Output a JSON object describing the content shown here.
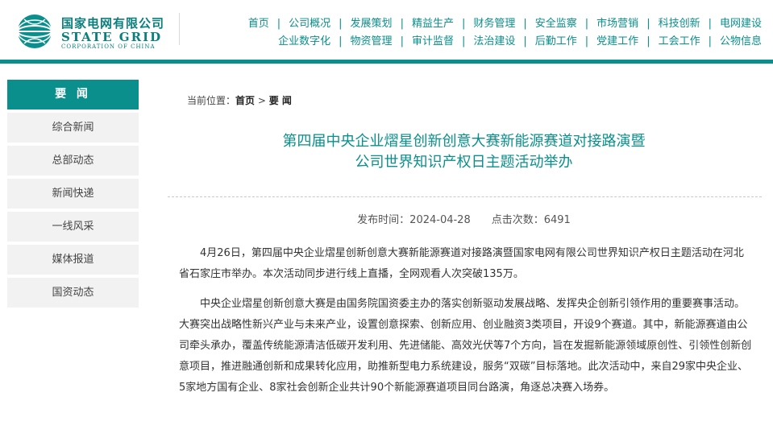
{
  "logo": {
    "cn": "国家电网有限公司",
    "en": "STATE GRID",
    "sub": "CORPORATION OF CHINA"
  },
  "nav": {
    "row1": [
      "首页",
      "公司概况",
      "发展策划",
      "精益生产",
      "财务管理",
      "安全监察",
      "市场营销",
      "科技创新",
      "电网建设"
    ],
    "row2": [
      "企业数字化",
      "物资管理",
      "审计监督",
      "法治建设",
      "后勤工作",
      "党建工作",
      "工会工作",
      "公物信息"
    ]
  },
  "sidebar": {
    "header": "要 闻",
    "items": [
      "综合新闻",
      "总部动态",
      "新闻快递",
      "一线风采",
      "媒体报道",
      "国资动态"
    ]
  },
  "breadcrumb": {
    "prefix": "当前位置：",
    "home": "首页",
    "sep": " > ",
    "current": "要 闻"
  },
  "article": {
    "title_line1": "第四届中央企业熠星创新创意大赛新能源赛道对接路演暨",
    "title_line2": "公司世界知识产权日主题活动举办",
    "publish_time": "发布时间：2024-04-28",
    "clicks": "点击次数：6491",
    "paragraphs": [
      "4月26日，第四届中央企业熠星创新创意大赛新能源赛道对接路演暨国家电网有限公司世界知识产权日主题活动在河北省石家庄市举办。本次活动同步进行线上直播，全网观看人次突破135万。",
      "中央企业熠星创新创意大赛是由国务院国资委主办的落实创新驱动发展战略、发挥央企创新引领作用的重要赛事活动。大赛突出战略性新兴产业与未来产业，设置创意探索、创新应用、创业融资3类项目，开设9个赛道。其中，新能源赛道由公司牵头承办，覆盖传统能源清洁低碳开发利用、先进储能、高效光伏等7个方向，旨在发掘新能源领域原创性、引领性创新创意项目，推进融通创新和成果转化应用，助推新型电力系统建设，服务“双碳”目标落地。此次活动中，来自29家中央企业、5家地方国有企业、8家社会创新企业共计90个新能源赛道项目同台路演，角逐总决赛入场券。"
    ]
  },
  "colors": {
    "accent": "#0a8f8c",
    "sidebar_bg": "#f2f2f2",
    "page_bg": "#f5f5f5"
  }
}
